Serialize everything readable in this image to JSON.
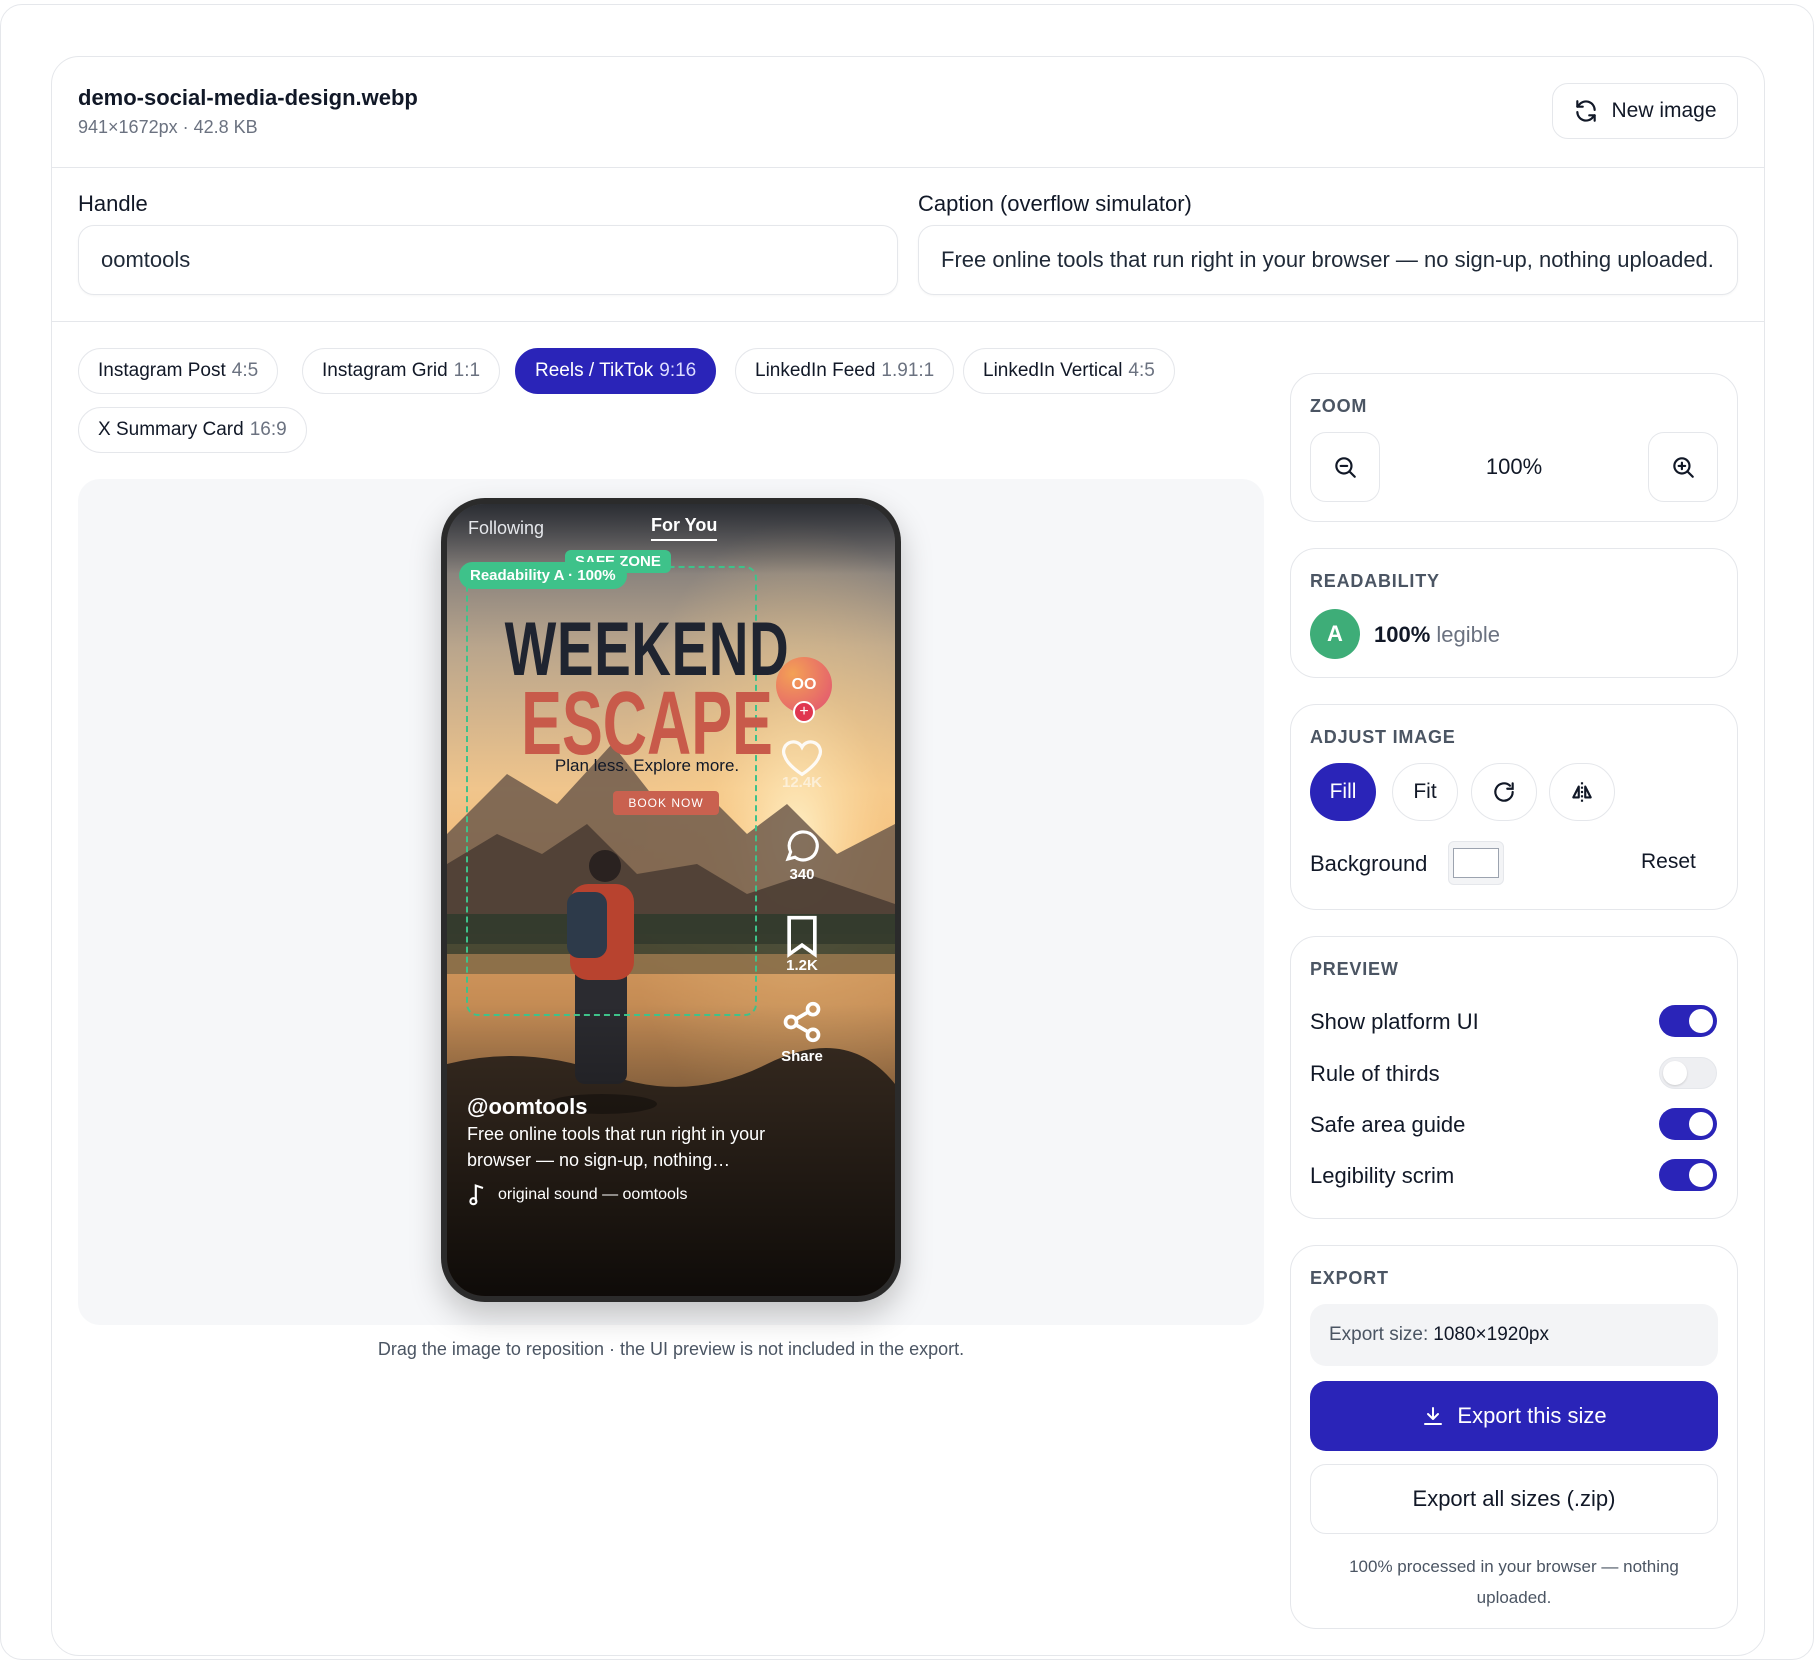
{
  "file": {
    "name": "demo-social-media-design.webp",
    "meta": "941×1672px · 42.8 KB"
  },
  "new_image_label": "New image",
  "fields": {
    "handle_label": "Handle",
    "handle_value": "oomtools",
    "caption_label": "Caption (overflow simulator)",
    "caption_value": "Free online tools that run right in your browser — no sign-up, nothing uploaded."
  },
  "formats": [
    {
      "name": "Instagram Post",
      "ratio": "4:5",
      "active": false
    },
    {
      "name": "Instagram Grid",
      "ratio": "1:1",
      "active": false
    },
    {
      "name": "Reels / TikTok",
      "ratio": "9:16",
      "active": true
    },
    {
      "name": "LinkedIn Feed",
      "ratio": "1.91:1",
      "active": false
    },
    {
      "name": "LinkedIn Vertical",
      "ratio": "4:5",
      "active": false
    },
    {
      "name": "X Summary Card",
      "ratio": "16:9",
      "active": false
    }
  ],
  "preview": {
    "tab_following": "Following",
    "tab_for_you": "For You",
    "safe_zone": "SAFE ZONE",
    "readability_badge": "Readability A · 100%",
    "headline_1": "WEEKEND",
    "headline_2": "ESCAPE",
    "tagline": "Plan less. Explore more.",
    "cta": "BOOK NOW",
    "avatar_initials": "OO",
    "likes": "12.4K",
    "comments": "340",
    "saves": "1.2K",
    "share": "Share",
    "handle": "@oomtools",
    "caption_line1": "Free online tools that run right in your",
    "caption_line2": "browser — no sign-up, nothing…",
    "sound": "original sound — oomtools",
    "colors": {
      "safe": "#3ec28a",
      "escape": "#c85a4a",
      "weekend": "#1f2430",
      "cta": "#c9614f"
    }
  },
  "hint": "Drag the image to reposition · the UI preview is not included in the export.",
  "zoom": {
    "title": "ZOOM",
    "value": "100%"
  },
  "readability": {
    "title": "READABILITY",
    "grade": "A",
    "percent": "100%",
    "word": "legible"
  },
  "adjust": {
    "title": "ADJUST IMAGE",
    "fill": "Fill",
    "fit": "Fit",
    "background_label": "Background",
    "reset": "Reset",
    "background_color": "#ffffff"
  },
  "preview_panel": {
    "title": "PREVIEW",
    "toggles": [
      {
        "label": "Show platform UI",
        "on": true
      },
      {
        "label": "Rule of thirds",
        "on": false
      },
      {
        "label": "Safe area guide",
        "on": true
      },
      {
        "label": "Legibility scrim",
        "on": true
      }
    ]
  },
  "export": {
    "title": "EXPORT",
    "size_label": "Export size:",
    "size_value": "1080×1920px",
    "export_this": "Export this size",
    "export_all": "Export all sizes (.zip)",
    "note": "100% processed in your browser — nothing uploaded."
  },
  "accent": "#2a24b8"
}
